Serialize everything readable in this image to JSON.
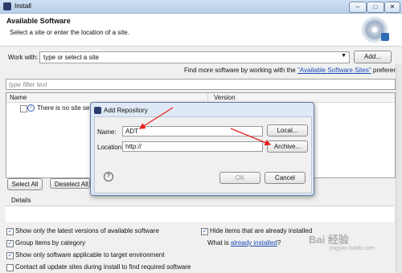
{
  "window": {
    "title": "Install"
  },
  "header": {
    "title": "Available Software",
    "subtitle": "Select a site or enter the location of a site."
  },
  "work_with": {
    "label": "Work with:",
    "value": "type or select a site",
    "add_label": "Add...",
    "find_more_prefix": "Find more software by working with the ",
    "find_more_link": "\"Available Software Sites\"",
    "find_more_suffix": " preferences."
  },
  "filter": {
    "placeholder": "type filter text"
  },
  "table": {
    "columns": [
      "Name",
      "Version"
    ],
    "rows": [
      {
        "name": "There is no site selec"
      }
    ]
  },
  "buttons": {
    "select_all": "Select All",
    "deselect_all": "Deselect All"
  },
  "details": {
    "label": "Details"
  },
  "options": {
    "latest_versions": "Show only the latest versions of available software",
    "group_items": "Group items by category",
    "target_env": "Show only software applicable to target environment",
    "contact_sites": "Contact all update sites during install to find required software",
    "hide_installed": "Hide items that are already installed",
    "what_is_prefix": "What is ",
    "already_installed_link": "already installed",
    "what_is_suffix": "?"
  },
  "dialog": {
    "title": "Add Repository",
    "name_label": "Name:",
    "name_value": "ADT",
    "local_label": "Local...",
    "location_label": "Location:",
    "location_value": "http://",
    "archive_label": "Archive...",
    "ok_label": "OK",
    "cancel_label": "Cancel",
    "help_glyph": "?"
  },
  "watermark": {
    "text": "Bai 经验",
    "sub": "jingyan.baidu.com"
  },
  "colors": {
    "link": "#1a49b8",
    "arrow": "#e8211d"
  }
}
